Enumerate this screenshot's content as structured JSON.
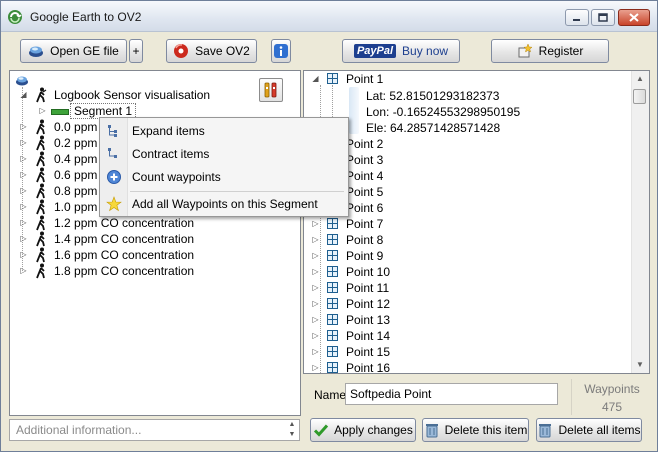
{
  "window": {
    "title": "Google Earth to OV2",
    "icon": "recycle-globe-icon",
    "controls": {
      "minimize": "minimize-icon",
      "maximize": "maximize-icon",
      "close": "close-icon"
    }
  },
  "toolbar": {
    "open_ge_label": "Open GE file",
    "plus_label": "+",
    "save_ov2_label": "Save OV2",
    "buy_now_label": "Buy now",
    "paypal_logo_text": "PayPal",
    "register_label": "Register"
  },
  "left_tree": {
    "root_label": "Logbook Sensor visualisation",
    "segment_label": "Segment 1",
    "items": [
      "0.0 ppm CO concentration",
      "0.2 ppm CO concentration",
      "0.4 ppm CO concentration",
      "0.6 ppm CO concentration",
      "0.8 ppm CO concentration",
      "1.0 ppm CO concentration",
      "1.2 ppm CO concentration",
      "1.4 ppm CO concentration",
      "1.6 ppm CO concentration",
      "1.8 ppm CO concentration"
    ]
  },
  "context_menu": {
    "items": [
      {
        "label": "Expand items",
        "icon": "expand-tree-icon"
      },
      {
        "label": "Contract items",
        "icon": "contract-tree-icon"
      },
      {
        "label": "Count waypoints",
        "icon": "plus-circle-icon"
      },
      {
        "label": "Add all Waypoints on this Segment",
        "icon": "star-icon"
      }
    ]
  },
  "right_tree": {
    "point1": {
      "label": "Point 1",
      "lat": "Lat: 52.81501293182373",
      "lon": "Lon: -0.16524553298950195",
      "ele": "Ele: 64.28571428571428"
    },
    "points": [
      "Point 2",
      "Point 3",
      "Point 4",
      "Point 5",
      "Point 6",
      "Point 7",
      "Point 8",
      "Point 9",
      "Point 10",
      "Point 11",
      "Point 12",
      "Point 13",
      "Point 14",
      "Point 15",
      "Point 16"
    ]
  },
  "details": {
    "name_label": "Name",
    "name_value": "Softpedia Point",
    "waypoints_label": "Waypoints",
    "waypoints_count": "475"
  },
  "info": {
    "placeholder": "Additional information..."
  },
  "actions": {
    "apply_label": "Apply changes",
    "delete_item_label": "Delete this item",
    "delete_all_label": "Delete all items"
  }
}
